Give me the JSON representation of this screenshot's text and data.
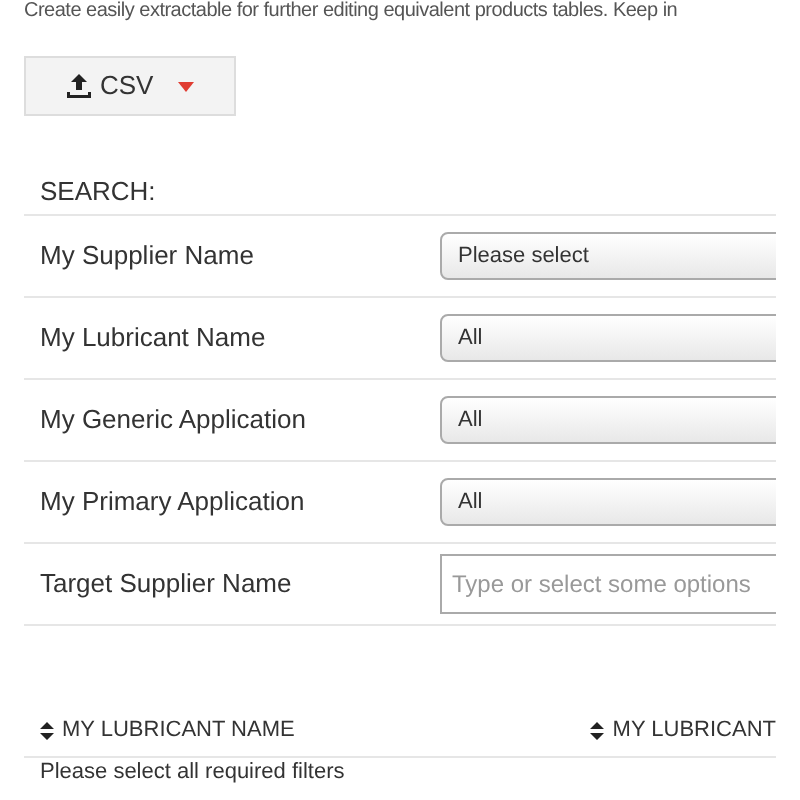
{
  "intro": "Create easily extractable for further editing equivalent products tables. Keep in",
  "export_button": {
    "label": "CSV"
  },
  "search": {
    "title": "SEARCH:",
    "filters": [
      {
        "label": "My Supplier Name",
        "kind": "select",
        "value": "Please select"
      },
      {
        "label": "My Lubricant Name",
        "kind": "select",
        "value": "All"
      },
      {
        "label": "My Generic Application",
        "kind": "select",
        "value": "All"
      },
      {
        "label": "My Primary Application",
        "kind": "select",
        "value": "All"
      },
      {
        "label": "Target Supplier Name",
        "kind": "multiselect",
        "placeholder": "Type or select some options"
      }
    ]
  },
  "table": {
    "columns": [
      "MY LUBRICANT NAME",
      "MY LUBRICANT"
    ],
    "empty_message": "Please select all required filters"
  }
}
